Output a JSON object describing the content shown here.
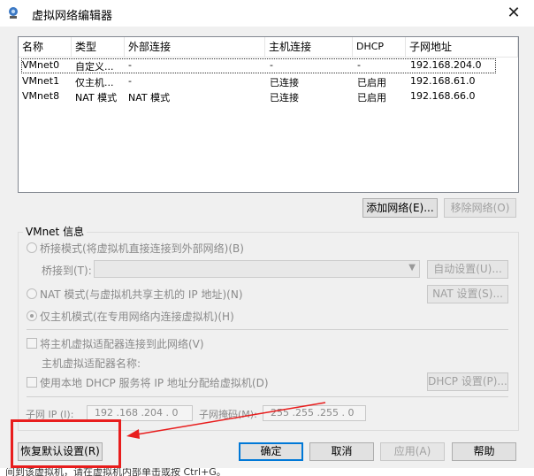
{
  "window": {
    "title": "虚拟网络编辑器",
    "close_glyph": "✕"
  },
  "list": {
    "headers": [
      "名称",
      "类型",
      "外部连接",
      "主机连接",
      "DHCP",
      "子网地址"
    ],
    "rows": [
      [
        "VMnet0",
        "自定义...",
        "-",
        "-",
        "-",
        "192.168.204.0"
      ],
      [
        "VMnet1",
        "仅主机...",
        "-",
        "已连接",
        "已启用",
        "192.168.61.0"
      ],
      [
        "VMnet8",
        "NAT 模式",
        "NAT 模式",
        "已连接",
        "已启用",
        "192.168.66.0"
      ]
    ]
  },
  "buttons": {
    "add_network": "添加网络(E)...",
    "remove_network": "移除网络(O)",
    "auto_settings": "自动设置(U)...",
    "nat_settings": "NAT 设置(S)...",
    "dhcp_settings": "DHCP 设置(P)...",
    "restore_defaults": "恢复默认设置(R)",
    "ok": "确定",
    "cancel": "取消",
    "apply": "应用(A)",
    "help": "帮助"
  },
  "vmnet_info": {
    "group_label": "VMnet 信息",
    "bridged_label": "桥接模式(将虚拟机直接连接到外部网络)(B)",
    "bridged_to_label": "桥接到(T):",
    "bridged_to_value": "",
    "nat_label": "NAT 模式(与虚拟机共享主机的 IP 地址)(N)",
    "host_only_label": "仅主机模式(在专用网络内连接虚拟机)(H)",
    "connect_adapter_label": "将主机虚拟适配器连接到此网络(V)",
    "adapter_name_label": "主机虚拟适配器名称:",
    "use_dhcp_label": "使用本地 DHCP 服务将 IP 地址分配给虚拟机(D)",
    "subnet_ip_label": "子网 IP (I):",
    "subnet_ip_value": "192 .168 .204 .  0",
    "subnet_mask_label": "子网掩码(M):",
    "subnet_mask_value": "255 .255 .255 .  0"
  },
  "selected_mode": "host-only",
  "background_text": "间到该虚拟机，请在虚拟机内部单击或按 Ctrl+G。",
  "colors": {
    "annotation_red": "#e81d1d",
    "default_button_border": "#0078d7"
  }
}
